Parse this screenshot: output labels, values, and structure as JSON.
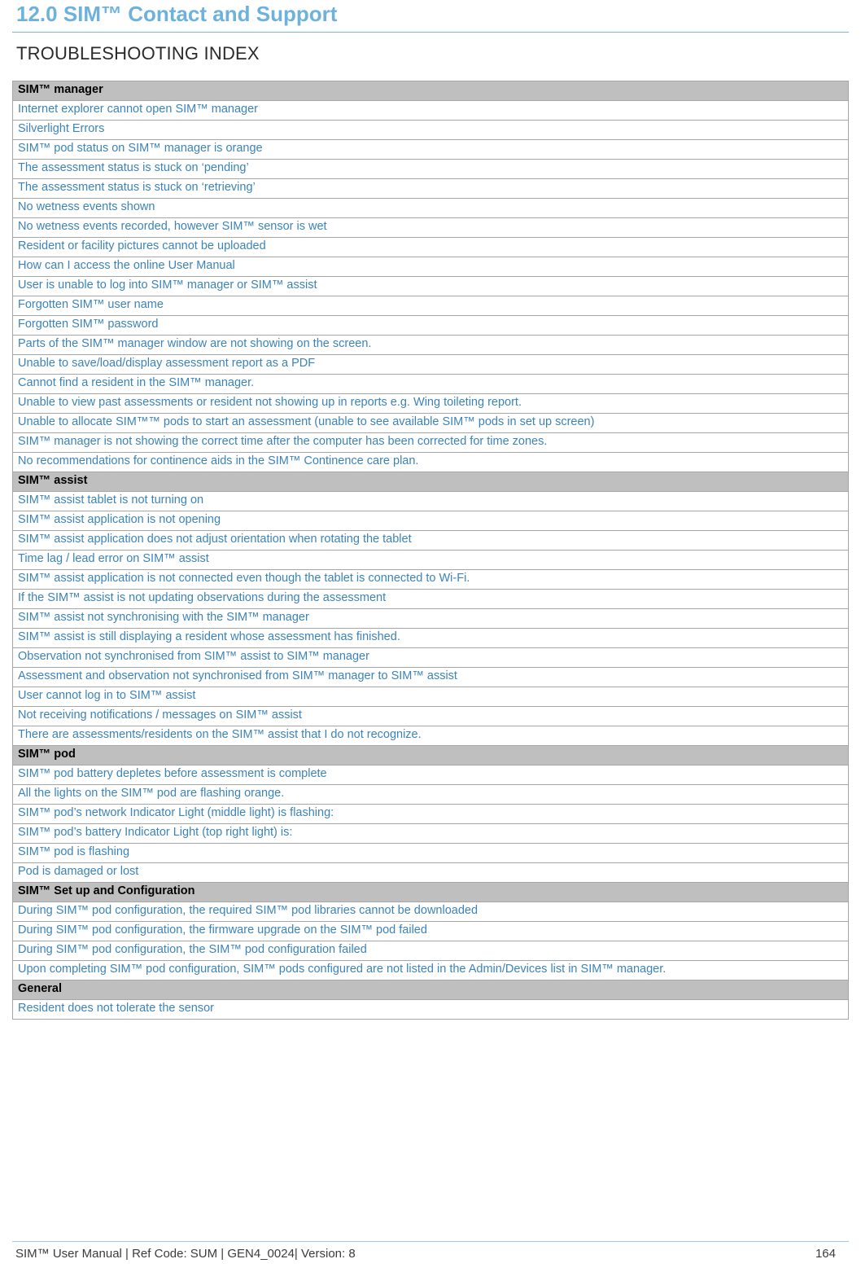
{
  "document": {
    "title": "12.0 SIM™ Contact and Support",
    "section_heading": "TROUBLESHOOTING INDEX"
  },
  "index": {
    "groups": [
      {
        "name": "SIM™ manager",
        "entries": [
          "Internet explorer cannot open SIM™ manager",
          "Silverlight Errors",
          "SIM™ pod status on SIM™ manager is orange",
          "The assessment status is stuck on ‘pending’",
          "The assessment status is stuck on ‘retrieving’",
          "No wetness events shown",
          "No wetness events recorded, however SIM™ sensor is wet",
          "Resident or facility pictures cannot be uploaded",
          "How can I access the online User Manual",
          "User is unable to log into SIM™ manager or SIM™ assist",
          "Forgotten SIM™ user name",
          "Forgotten  SIM™ password",
          "Parts of the SIM™ manager window are not showing on the screen.",
          "Unable to save/load/display assessment report as a PDF",
          "Cannot find a resident in the SIM™ manager.",
          "Unable to view past assessments or resident not showing up in reports e.g. Wing toileting report.",
          "Unable to allocate SIM™™ pods to start an assessment (unable to see available SIM™ pods in set up screen)",
          "SIM™ manager is not showing the correct time after the computer has been corrected for time zones.",
          "No recommendations for continence aids in the SIM™ Continence care plan."
        ]
      },
      {
        "name": "SIM™ assist",
        "entries": [
          "SIM™ assist tablet is not turning on",
          "SIM™ assist application is not opening",
          "SIM™ assist application does not adjust orientation when rotating the tablet",
          "Time lag / lead error on SIM™ assist",
          "SIM™ assist application is not connected even though the tablet is connected to Wi-Fi.",
          "If the SIM™ assist is not updating observations during the assessment",
          "SIM™ assist not synchronising with the SIM™ manager",
          "SIM™ assist is still displaying a resident whose assessment has finished.",
          "Observation not synchronised from SIM™ assist to SIM™ manager",
          "Assessment and observation not synchronised from SIM™ manager to SIM™ assist",
          "User cannot log in to SIM™ assist",
          "Not receiving notifications / messages on SIM™ assist",
          "There are assessments/residents on the SIM™ assist that I do not recognize."
        ]
      },
      {
        "name": "SIM™ pod",
        "entries": [
          "SIM™ pod battery depletes before assessment is complete",
          "All the lights on the SIM™ pod are flashing orange.",
          "SIM™ pod’s network Indicator Light (middle light) is flashing:",
          "SIM™ pod’s battery Indicator Light (top right light) is:",
          "SIM™ pod is flashing",
          "Pod is damaged or lost"
        ]
      },
      {
        "name": "SIM™ Set up and Configuration",
        "entries": [
          "During SIM™ pod configuration, the required SIM™ pod libraries cannot be downloaded",
          "During SIM™ pod configuration, the firmware upgrade on the SIM™ pod failed",
          "During SIM™ pod configuration, the SIM™ pod configuration failed",
          "Upon completing SIM™ pod configuration, SIM™ pods configured are not listed in the Admin/Devices list in SIM™ manager."
        ]
      },
      {
        "name": "General",
        "entries": [
          "Resident does not tolerate the sensor"
        ]
      }
    ]
  },
  "footer": {
    "left": "SIM™ User Manual | Ref Code: SUM | GEN4_0024| Version: 8",
    "page_number": "164"
  },
  "colors": {
    "title": "#6db2dd",
    "link_text": "#3c83b8",
    "group_header_bg": "#bfbfbf",
    "border": "#a6a6a6"
  }
}
